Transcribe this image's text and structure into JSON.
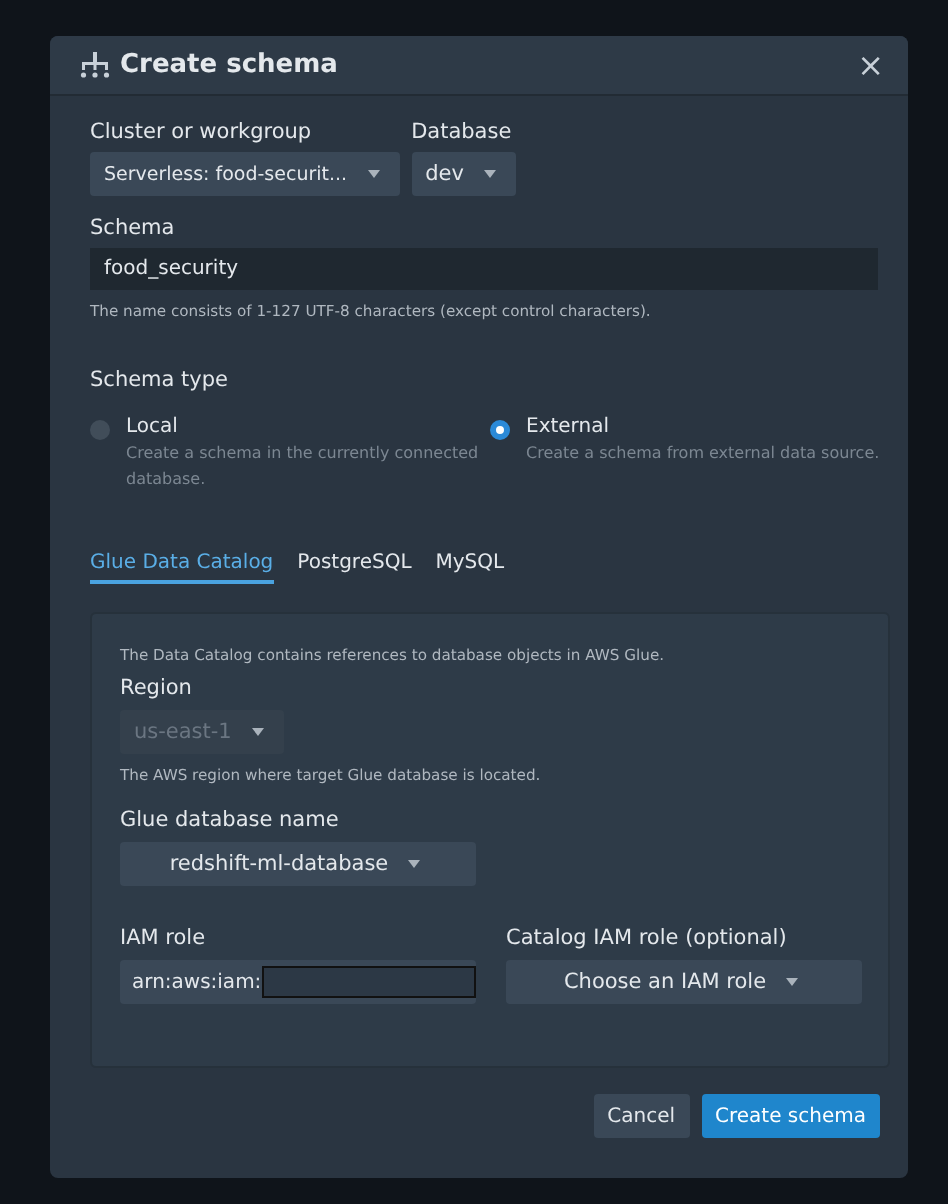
{
  "dialog": {
    "title": "Create schema",
    "close": "×"
  },
  "cluster": {
    "label": "Cluster or workgroup",
    "value": "Serverless: food-securit..."
  },
  "database": {
    "label": "Database",
    "value": "dev"
  },
  "schema": {
    "label": "Schema",
    "value": "food_security",
    "hint": "The name consists of 1-127 UTF-8 characters (except control characters)."
  },
  "schema_type": {
    "label": "Schema type",
    "options": [
      {
        "label": "Local",
        "description": "Create a schema in the currently connected database.",
        "selected": false
      },
      {
        "label": "External",
        "description": "Create a schema from external data source.",
        "selected": true
      }
    ]
  },
  "tabs": [
    {
      "label": "Glue Data Catalog",
      "selected": true
    },
    {
      "label": "PostgreSQL",
      "selected": false
    },
    {
      "label": "MySQL",
      "selected": false
    }
  ],
  "panel": {
    "intro": "The Data Catalog contains references to database objects in AWS Glue.",
    "region": {
      "label": "Region",
      "value": "us-east-1",
      "disabled": true,
      "hint": "The AWS region where target Glue database is located."
    },
    "glue_db": {
      "label": "Glue database name",
      "value": "redshift-ml-database"
    },
    "iam_role": {
      "label": "IAM role",
      "value": "arn:aws:iam:",
      "redacted": true
    },
    "catalog_role": {
      "label": "Catalog IAM role (optional)",
      "placeholder": "Choose an IAM role"
    }
  },
  "buttons": [
    {
      "label": "Cancel",
      "kind": "secondary"
    },
    {
      "label": "Create schema",
      "kind": "primary"
    }
  ]
}
